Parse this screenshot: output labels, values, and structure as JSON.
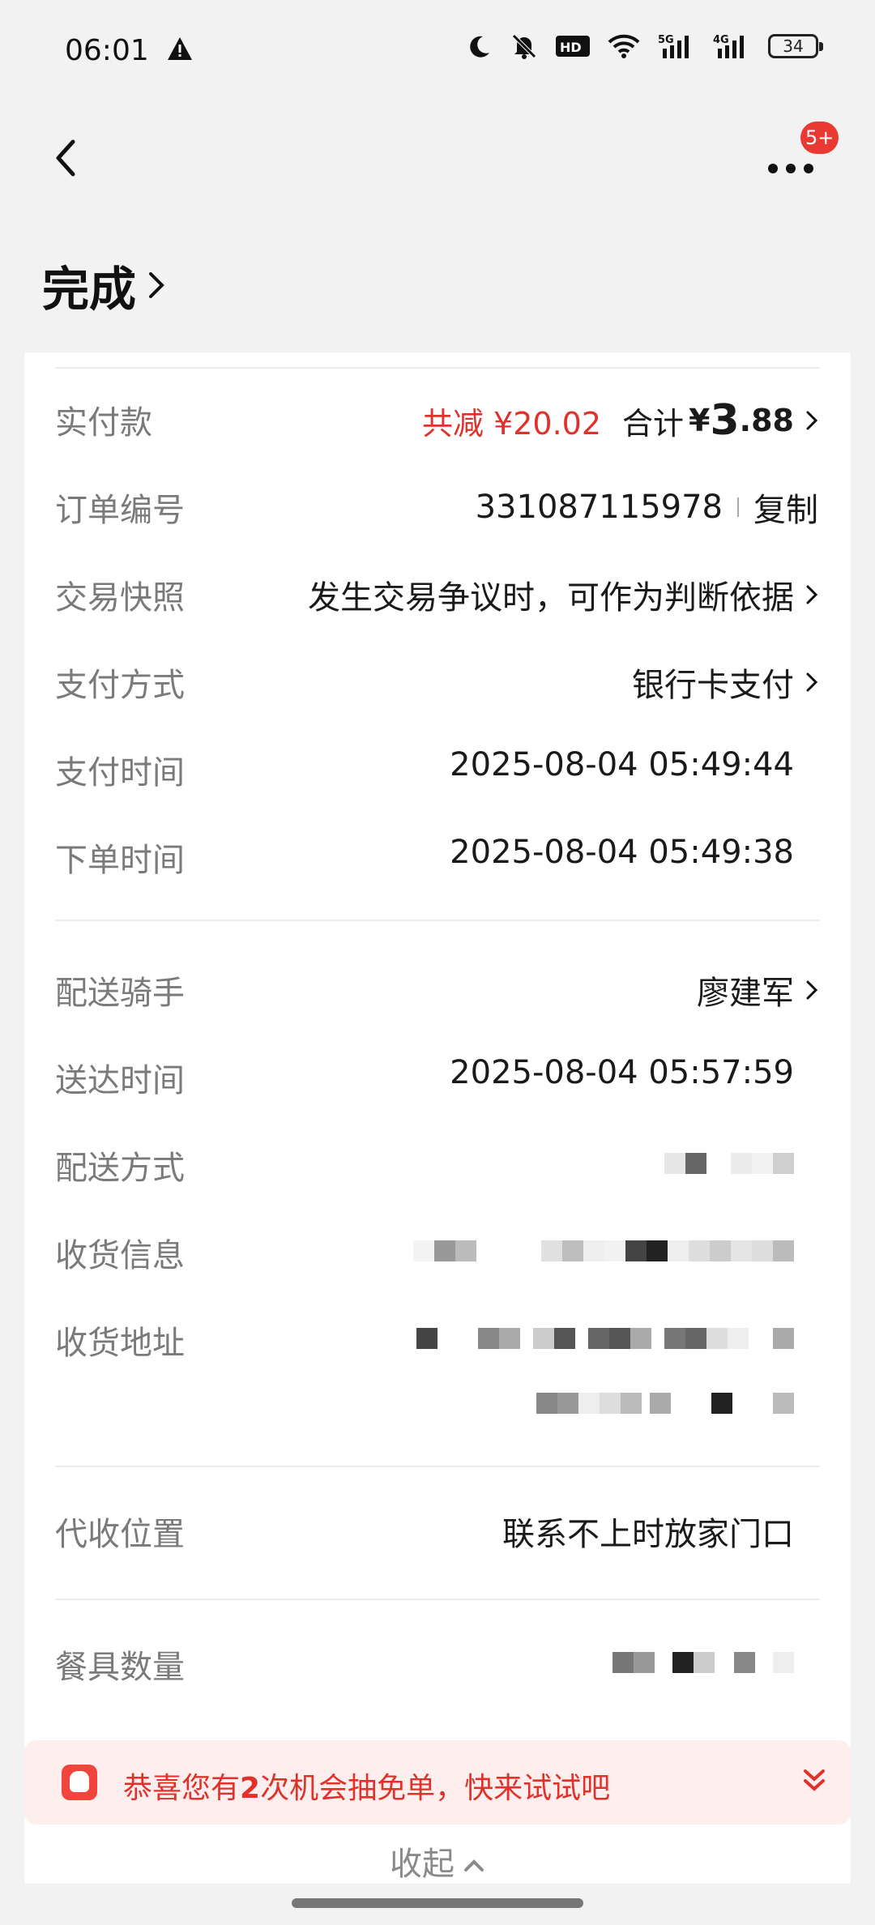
{
  "status_bar": {
    "time": "06:01",
    "battery": "34",
    "icons": [
      "warning-icon",
      "moon-icon",
      "mute-icon",
      "hd-icon",
      "wifi-icon",
      "signal-5g-icon",
      "signal-4g-icon",
      "battery-icon"
    ]
  },
  "nav": {
    "badge": "5+"
  },
  "order_status": "完成",
  "payment": {
    "label": "实付款",
    "discount": "共减 ¥20.02",
    "total_label": "合计",
    "currency": "¥",
    "amount_int": "3",
    "amount_dec": ".88"
  },
  "rows": {
    "order_no": {
      "label": "订单编号",
      "value": "331087115978",
      "copy": "复制"
    },
    "snapshot": {
      "label": "交易快照",
      "value": "发生交易争议时，可作为判断依据"
    },
    "pay_method": {
      "label": "支付方式",
      "value": "银行卡支付"
    },
    "pay_time": {
      "label": "支付时间",
      "value": "2025-08-04 05:49:44"
    },
    "order_time": {
      "label": "下单时间",
      "value": "2025-08-04 05:49:38"
    },
    "rider": {
      "label": "配送骑手",
      "value": "廖建军"
    },
    "delivered_time": {
      "label": "送达时间",
      "value": "2025-08-04 05:57:59"
    },
    "delivery_method": {
      "label": "配送方式"
    },
    "receiver_info": {
      "label": "收货信息"
    },
    "address": {
      "label": "收货地址"
    },
    "drop_location": {
      "label": "代收位置",
      "value": "联系不上时放家门口"
    },
    "tableware": {
      "label": "餐具数量"
    }
  },
  "promo": {
    "prefix": "恭喜您有",
    "count": "2",
    "suffix": "次机会抽免单，快来试试吧"
  },
  "collapse_label": "收起",
  "colors": {
    "accent_red": "#e0322b",
    "badge_red": "#e83a33",
    "promo_bg": "#ffeeee"
  }
}
